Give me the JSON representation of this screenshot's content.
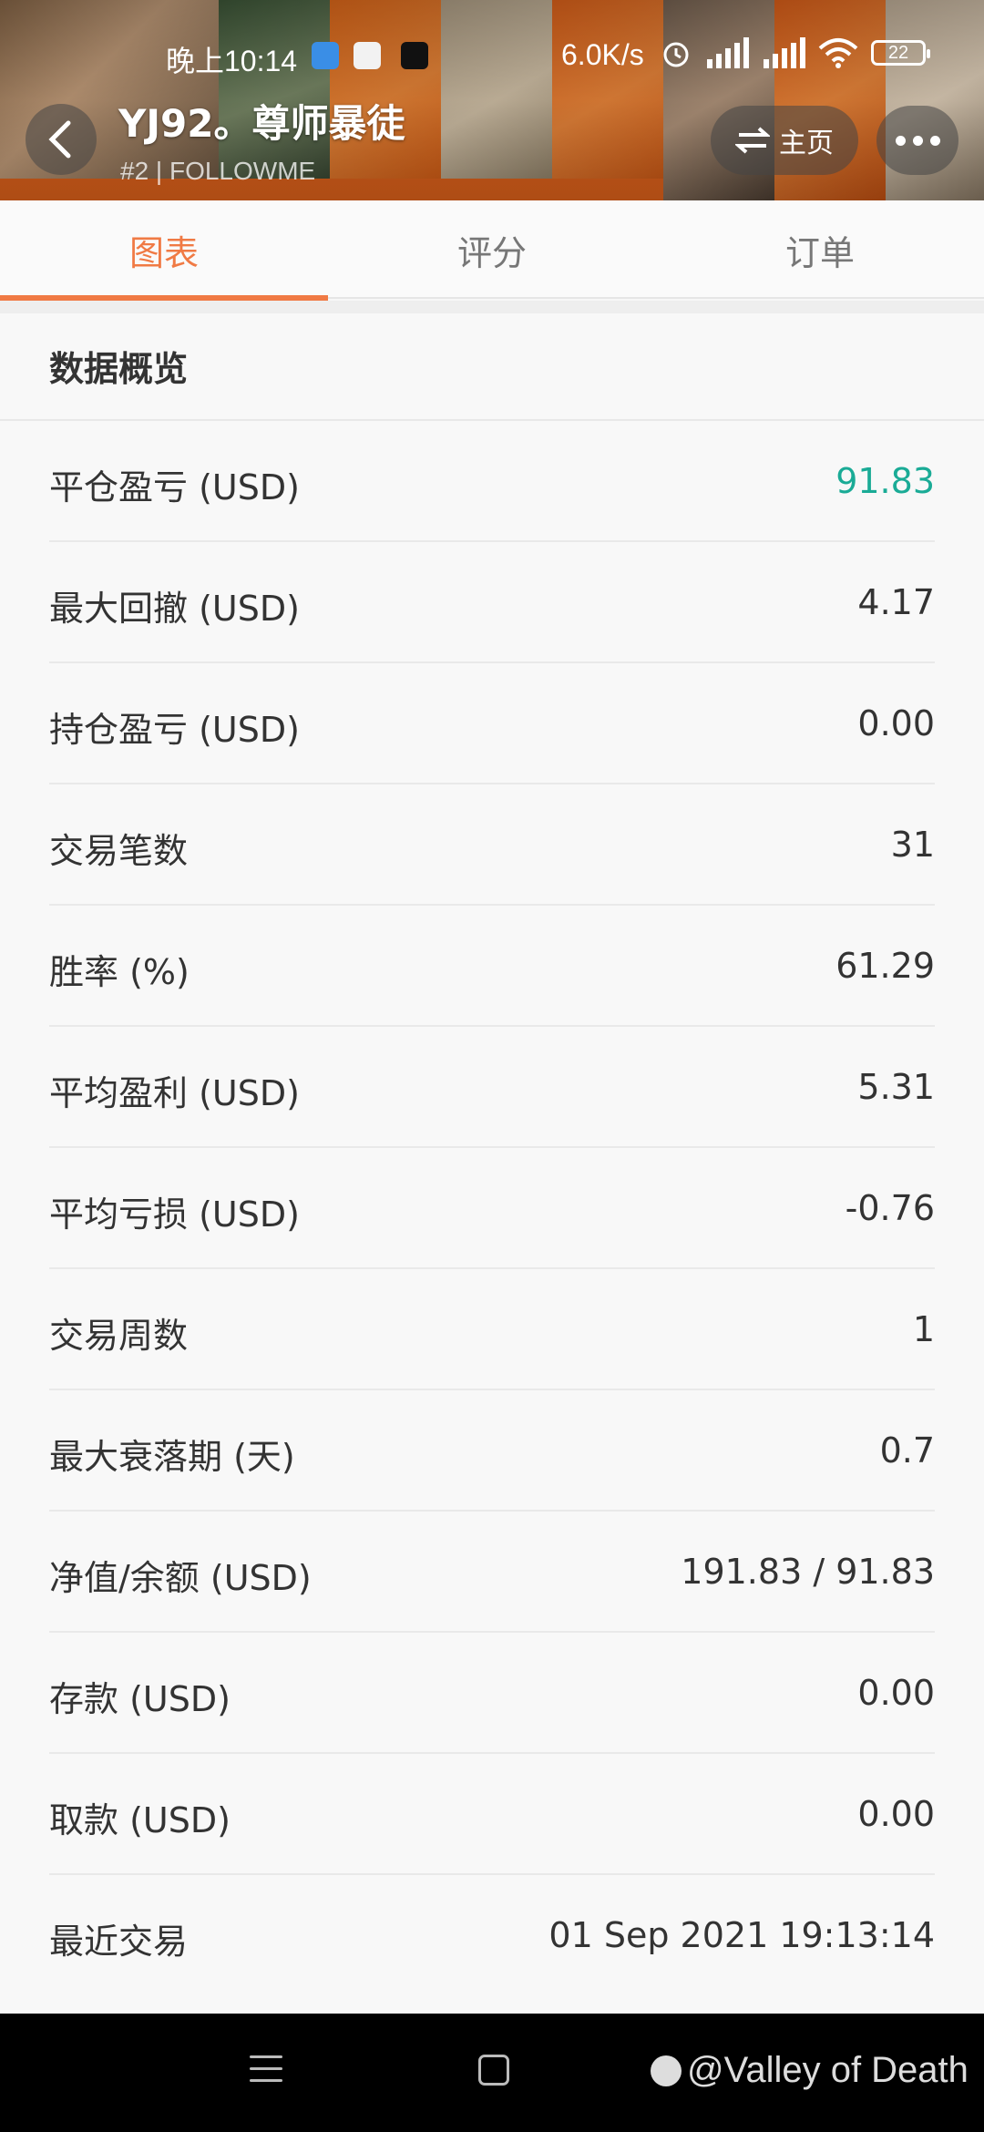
{
  "status_bar": {
    "time": "晚上10:14",
    "network_speed": "6.0K/s",
    "battery": "22"
  },
  "header": {
    "title": "YJ92。尊师暴徒",
    "subtitle": "#2 | FOLLOWME",
    "home_label": "主页"
  },
  "tabs": [
    {
      "label": "图表",
      "active": true
    },
    {
      "label": "评分",
      "active": false
    },
    {
      "label": "订单",
      "active": false
    }
  ],
  "overview": {
    "title": "数据概览",
    "rows": [
      {
        "label": "平仓盈亏 (USD)",
        "value": "91.83",
        "color": "#1aab96"
      },
      {
        "label": "最大回撤 (USD)",
        "value": "4.17"
      },
      {
        "label": "持仓盈亏 (USD)",
        "value": "0.00"
      },
      {
        "label": "交易笔数",
        "value": "31"
      },
      {
        "label": "胜率 (%)",
        "value": "61.29"
      },
      {
        "label": "平均盈利 (USD)",
        "value": "5.31"
      },
      {
        "label": "平均亏损 (USD)",
        "value": "-0.76"
      },
      {
        "label": "交易周数",
        "value": "1"
      },
      {
        "label": "最大衰落期 (天)",
        "value": "0.7"
      },
      {
        "label": "净值/余额 (USD)",
        "value": "191.83 / 91.83"
      },
      {
        "label": "存款 (USD)",
        "value": "0.00"
      },
      {
        "label": "取款 (USD)",
        "value": "0.00"
      },
      {
        "label": "最近交易",
        "value": "01 Sep 2021 19:13:14"
      }
    ]
  },
  "watermark": "@Valley of Death",
  "colors": {
    "accent": "#f07a44",
    "profit_green": "#1aab96",
    "banner_orange": "#e8661c"
  }
}
